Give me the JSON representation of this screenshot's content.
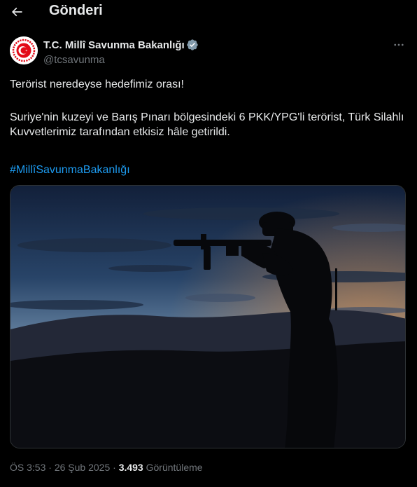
{
  "header": {
    "title": "Gönderi"
  },
  "author": {
    "name": "T.C. Millî Savunma Bakanlığı",
    "handle": "@tcsavunma"
  },
  "tweet": {
    "line1": "Terörist neredeyse hedefimiz orası!",
    "paragraph2": "Suriye'nin kuzeyi ve Barış Pınarı bölgesindeki 6 PKK/YPG'li terörist, Türk Silahlı Kuvvetlerimiz tarafından etkisiz hâle getirildi.",
    "hashtag": "#MillîSavunmaBakanlığı"
  },
  "meta": {
    "time": "ÖS 3:53",
    "sep1": " · ",
    "date": "26 Şub 2025",
    "sep2": " · ",
    "views_count": "3.493",
    "views_label": " Görüntüleme"
  },
  "icons": {
    "back": "arrow-left-icon",
    "verified": "verified-badge-icon",
    "more": "more-dots-icon"
  },
  "colors": {
    "background": "#000000",
    "text": "#e7e9ea",
    "secondary": "#71767b",
    "link": "#1d9bf0",
    "logo_red": "#e30a17"
  }
}
